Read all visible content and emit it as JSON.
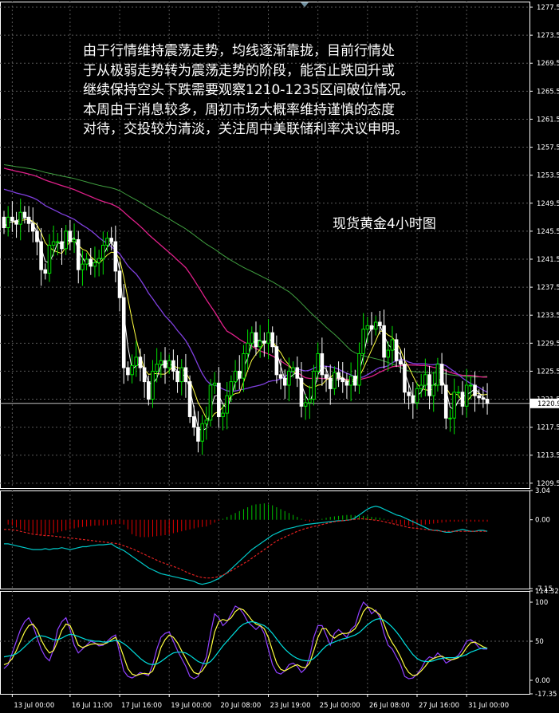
{
  "annotation": {
    "lines": [
      "由于行情维持震荡走势，均线逐渐靠拢，目前行情处",
      "于从极弱走势转为震荡走势的阶段，能否止跌回升或",
      "继续保持空头下跌需要观察1210-1235区间破位情况。",
      "本周由于消息较多，周初市场大概率维持谨慎的态度",
      "对待，交投较为清淡，关注周中美联储利率决议申明。"
    ]
  },
  "chart_data": [
    {
      "panel": "price",
      "type": "candlestick",
      "title": "现货黄金4小时图",
      "y_ticks": [
        "1277.5",
        "1273.5",
        "1269.5",
        "1265.5",
        "1261.5",
        "1257.5",
        "1253.5",
        "1249.5",
        "1245.5",
        "1241.5",
        "1237.5",
        "1233.5",
        "1229.5",
        "1225.5",
        "1221.5",
        "1217.5",
        "1213.5",
        "1209.5"
      ],
      "ylim": [
        1208.8,
        1278.3
      ],
      "current_price": "1220.9",
      "current_price_value": 1220.9,
      "x_tick_labels": [
        "13 Jul 00:00",
        "16 Jul 11:00",
        "17 Jul 16:00",
        "19 Jul 00:00",
        "20 Jul 08:00",
        "23 Jul 19:00",
        "25 Jul 00:00",
        "26 Jul 08:00",
        "27 Jul 16:00",
        "31 Jul 00:00"
      ],
      "x_tick_index": [
        2,
        16,
        28,
        40,
        52,
        64,
        76,
        88,
        100,
        112
      ],
      "closes": [
        1246.0,
        1247.5,
        1247.0,
        1246.5,
        1248.2,
        1247.5,
        1246.6,
        1245.5,
        1244.0,
        1240.0,
        1239.5,
        1243.5,
        1244.0,
        1244.0,
        1243.0,
        1245.5,
        1244.0,
        1244.3,
        1240.0,
        1240.8,
        1241.5,
        1240.5,
        1241.0,
        1241.6,
        1243.5,
        1244.5,
        1244.0,
        1239.8,
        1236.0,
        1226.0,
        1225.0,
        1226.3,
        1227.5,
        1226.0,
        1224.0,
        1221.5,
        1225.5,
        1226.5,
        1227.0,
        1226.0,
        1227.0,
        1225.5,
        1224.0,
        1226.0,
        1224.0,
        1219.0,
        1217.5,
        1215.5,
        1218.0,
        1218.5,
        1223.5,
        1223.8,
        1219.0,
        1219.5,
        1222.0,
        1224.0,
        1225.5,
        1224.5,
        1228.0,
        1229.5,
        1231.0,
        1229.0,
        1229.8,
        1229.5,
        1231.0,
        1229.0,
        1225.0,
        1224.5,
        1223.5,
        1225.5,
        1226.0,
        1224.5,
        1220.5,
        1221.0,
        1221.5,
        1225.5,
        1228.0,
        1225.0,
        1224.5,
        1223.0,
        1225.3,
        1224.5,
        1224.0,
        1223.5,
        1224.8,
        1223.5,
        1228.0,
        1231.5,
        1232.0,
        1231.5,
        1232.5,
        1232.0,
        1227.5,
        1228.5,
        1230.0,
        1227.0,
        1226.5,
        1222.5,
        1222.0,
        1221.0,
        1223.0,
        1223.5,
        1225.0,
        1222.0,
        1223.5,
        1226.5,
        1223.5,
        1218.8,
        1218.8,
        1222.5,
        1222.5,
        1220.5,
        1223.5,
        1223.5,
        1222.0,
        1221.7,
        1221.5,
        1220.9
      ]
    },
    {
      "panel": "oscillator",
      "type": "histogram-line",
      "y_ticks": [
        "3.04",
        "0.00",
        "-7.15"
      ],
      "ylim": [
        -7.15,
        3.04
      ],
      "histogram": [
        0.0,
        -0.5,
        -0.6,
        -0.8,
        -1.0,
        -1.1,
        -1.2,
        -1.4,
        -1.5,
        -1.6,
        -1.6,
        -1.5,
        -1.4,
        -1.3,
        -1.2,
        -1.1,
        -1.0,
        -0.9,
        -0.8,
        -0.75,
        -0.7,
        -0.65,
        -0.6,
        -0.6,
        -0.6,
        -0.55,
        -0.5,
        -0.45,
        -0.45,
        -0.5,
        -1.0,
        -1.5,
        -1.7,
        -1.8,
        -1.8,
        -1.8,
        -1.75,
        -1.7,
        -1.65,
        -1.6,
        -1.5,
        -1.4,
        -1.3,
        -1.2,
        -1.1,
        -1.0,
        -0.9,
        -0.8,
        -0.75,
        -0.7,
        -0.5,
        -0.3,
        -0.1,
        0.1,
        0.3,
        0.5,
        0.7,
        0.9,
        1.1,
        1.3,
        1.5,
        1.6,
        1.65,
        1.7,
        1.6,
        1.5,
        1.3,
        1.1,
        0.9,
        0.7,
        0.5,
        0.3,
        0.1,
        -0.1,
        -0.2,
        -0.1,
        0.0,
        0.1,
        0.2,
        0.3,
        0.35,
        0.4,
        0.45,
        0.5,
        0.5,
        0.45,
        0.4,
        0.4,
        0.35,
        0.3,
        0.25,
        0.2,
        0.1,
        -0.1,
        -0.3,
        -0.4,
        -0.5,
        -0.55,
        -0.6,
        -0.6,
        -0.6,
        -0.55,
        -0.5,
        -0.45,
        -0.4,
        -0.35,
        -0.3,
        -0.25,
        -0.2,
        -0.2,
        -0.2,
        -0.2,
        -0.2,
        -0.2,
        -0.2,
        -0.2,
        -0.2,
        -0.2
      ],
      "series": [
        {
          "color": "#00c8c8",
          "values": [
            -2.5,
            -2.5,
            -2.6,
            -2.7,
            -2.8,
            -2.9,
            -3.0,
            -3.1,
            -3.1,
            -3.1,
            -3.0,
            -3.1,
            -3.0,
            -3.0,
            -2.9,
            -3.0,
            -3.1,
            -3.0,
            -2.9,
            -2.8,
            -2.8,
            -2.7,
            -2.65,
            -2.6,
            -2.6,
            -2.55,
            -2.5,
            -2.8,
            -3.0,
            -3.2,
            -3.5,
            -3.8,
            -4.1,
            -4.4,
            -4.7,
            -5.0,
            -5.2,
            -5.4,
            -5.6,
            -5.7,
            -5.8,
            -5.9,
            -6.0,
            -6.1,
            -6.2,
            -6.3,
            -6.4,
            -6.6,
            -6.7,
            -6.6,
            -6.5,
            -6.3,
            -6.1,
            -5.8,
            -5.5,
            -5.1,
            -4.7,
            -4.3,
            -3.9,
            -3.5,
            -3.1,
            -2.8,
            -2.5,
            -2.2,
            -1.9,
            -1.6,
            -1.4,
            -1.2,
            -1.0,
            -0.9,
            -0.8,
            -0.7,
            -0.6,
            -0.5,
            -0.45,
            -0.4,
            -0.35,
            -0.3,
            -0.25,
            -0.2,
            -0.15,
            -0.1,
            -0.1,
            -0.05,
            0.0,
            0.2,
            0.5,
            0.8,
            1.1,
            1.3,
            1.4,
            1.3,
            1.1,
            0.9,
            0.7,
            0.5,
            0.4,
            0.2,
            0.0,
            -0.2,
            -0.4,
            -0.6,
            -0.8,
            -1.0,
            -1.1,
            -1.1,
            -1.2,
            -1.3,
            -1.3,
            -1.2,
            -1.1,
            -1.0,
            -1.1,
            -1.2,
            -1.2,
            -1.1,
            -1.1,
            -1.2
          ]
        },
        {
          "color": "#e02020",
          "dash": true,
          "values": [
            -1.0,
            -1.0,
            -1.05,
            -1.1,
            -1.2,
            -1.3,
            -1.4,
            -1.5,
            -1.55,
            -1.6,
            -1.65,
            -1.65,
            -1.7,
            -1.75,
            -1.8,
            -1.85,
            -1.9,
            -1.95,
            -2.0,
            -2.05,
            -2.1,
            -2.15,
            -2.2,
            -2.25,
            -2.3,
            -2.35,
            -2.4,
            -2.45,
            -2.55,
            -2.7,
            -2.85,
            -3.0,
            -3.2,
            -3.4,
            -3.6,
            -3.8,
            -4.0,
            -4.2,
            -4.4,
            -4.55,
            -4.7,
            -4.85,
            -5.0,
            -5.2,
            -5.4,
            -5.6,
            -5.75,
            -5.9,
            -6.0,
            -6.05,
            -6.05,
            -6.0,
            -5.9,
            -5.75,
            -5.55,
            -5.3,
            -5.05,
            -4.8,
            -4.55,
            -4.3,
            -4.0,
            -3.7,
            -3.4,
            -3.1,
            -2.8,
            -2.5,
            -2.2,
            -2.0,
            -1.8,
            -1.6,
            -1.4,
            -1.2,
            -1.05,
            -0.9,
            -0.8,
            -0.7,
            -0.6,
            -0.5,
            -0.4,
            -0.3,
            -0.2,
            -0.15,
            -0.1,
            -0.05,
            0.0,
            0.05,
            0.1,
            0.1,
            0.05,
            0.0,
            -0.05,
            -0.1,
            -0.2,
            -0.3,
            -0.4,
            -0.5,
            -0.6,
            -0.7,
            -0.8,
            -0.85,
            -0.9,
            -0.95,
            -1.0,
            -1.05,
            -1.1,
            -1.15,
            -1.2,
            -1.2,
            -1.2,
            -1.2,
            -1.2,
            -1.2,
            -1.2,
            -1.2,
            -1.2,
            -1.2,
            -1.2,
            -1.2
          ]
        }
      ]
    },
    {
      "panel": "stochastic",
      "type": "line",
      "y_ticks": [
        "114.32",
        "100",
        "50",
        "0.00",
        "-17.35"
      ],
      "ylim": [
        -17.35,
        114.32
      ],
      "series": [
        {
          "color": "#9040ff",
          "values": [
            15,
            20,
            35,
            50,
            65,
            75,
            80,
            70,
            55,
            40,
            30,
            25,
            40,
            65,
            75,
            80,
            65,
            45,
            35,
            40,
            45,
            50,
            48,
            44,
            45,
            50,
            55,
            58,
            35,
            12,
            5,
            3,
            6,
            10,
            8,
            6,
            20,
            40,
            55,
            60,
            62,
            50,
            38,
            28,
            18,
            5,
            2,
            5,
            18,
            30,
            60,
            85,
            80,
            70,
            75,
            85,
            95,
            92,
            85,
            75,
            70,
            65,
            70,
            60,
            40,
            20,
            10,
            8,
            12,
            20,
            22,
            18,
            10,
            15,
            30,
            55,
            70,
            70,
            58,
            45,
            60,
            65,
            60,
            55,
            65,
            70,
            88,
            100,
            95,
            85,
            90,
            80,
            60,
            45,
            40,
            30,
            20,
            5,
            2,
            3,
            8,
            15,
            25,
            30,
            28,
            35,
            30,
            22,
            25,
            28,
            32,
            40,
            50,
            52,
            48,
            42,
            40,
            40
          ]
        },
        {
          "color": "#ffff40",
          "values": [
            20,
            22,
            28,
            38,
            50,
            62,
            70,
            72,
            65,
            52,
            42,
            35,
            38,
            50,
            64,
            72,
            70,
            58,
            45,
            42,
            44,
            46,
            47,
            46,
            46,
            48,
            52,
            55,
            45,
            30,
            15,
            8,
            6,
            8,
            9,
            8,
            12,
            25,
            42,
            52,
            58,
            55,
            48,
            38,
            28,
            18,
            10,
            8,
            12,
            20,
            38,
            62,
            75,
            78,
            76,
            80,
            88,
            92,
            90,
            84,
            77,
            72,
            70,
            66,
            55,
            38,
            22,
            14,
            12,
            15,
            18,
            20,
            17,
            16,
            22,
            38,
            55,
            66,
            66,
            58,
            54,
            58,
            60,
            60,
            62,
            66,
            75,
            88,
            94,
            92,
            88,
            84,
            72,
            58,
            48,
            40,
            30,
            18,
            10,
            6,
            7,
            12,
            18,
            25,
            28,
            30,
            31,
            28,
            26,
            27,
            29,
            34,
            42,
            48,
            49,
            46,
            43,
            41
          ]
        },
        {
          "color": "#00e0e0",
          "values": [
            30,
            31,
            32,
            34,
            38,
            43,
            48,
            53,
            56,
            57,
            56,
            54,
            52,
            52,
            54,
            57,
            59,
            58,
            56,
            54,
            52,
            51,
            50,
            50,
            49,
            49,
            50,
            51,
            50,
            47,
            43,
            38,
            33,
            28,
            24,
            21,
            20,
            21,
            24,
            28,
            32,
            35,
            36,
            36,
            35,
            32,
            28,
            24,
            22,
            21,
            24,
            30,
            37,
            44,
            50,
            56,
            62,
            68,
            72,
            74,
            75,
            74,
            72,
            70,
            66,
            60,
            53,
            46,
            40,
            35,
            31,
            28,
            26,
            25,
            25,
            28,
            33,
            39,
            44,
            47,
            49,
            51,
            53,
            54,
            56,
            58,
            61,
            66,
            71,
            75,
            78,
            79,
            77,
            73,
            68,
            62,
            55,
            47,
            40,
            33,
            28,
            25,
            24,
            24,
            25,
            27,
            28,
            29,
            29,
            29,
            30,
            31,
            33,
            36,
            38,
            40,
            41,
            41
          ]
        }
      ]
    }
  ]
}
